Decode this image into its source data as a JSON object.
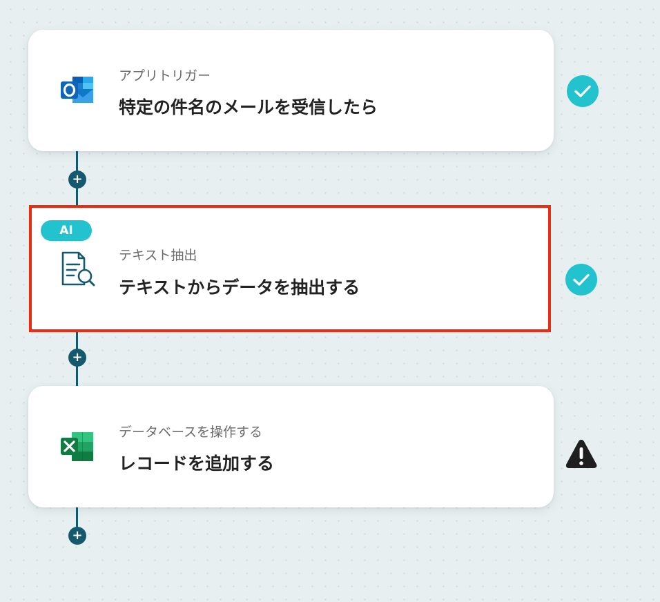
{
  "flow": {
    "steps": [
      {
        "subtitle": "アプリトリガー",
        "title": "特定の件名のメールを受信したら",
        "icon": "outlook-icon",
        "status": "complete",
        "status_icon": "check-circle-icon"
      },
      {
        "badge": "AI",
        "subtitle": "テキスト抽出",
        "title": "テキストからデータを抽出する",
        "icon": "document-search-icon",
        "status": "complete",
        "status_icon": "check-circle-icon",
        "selected": true
      },
      {
        "subtitle": "データベースを操作する",
        "title": "レコードを追加する",
        "icon": "excel-icon",
        "status": "warning",
        "status_icon": "warning-icon"
      }
    ],
    "add_step_label": "+"
  },
  "colors": {
    "connector": "#15596e",
    "check": "#22c3cf",
    "highlight": "#ee2a10",
    "ai_badge": "#22c3cf",
    "warning": "#1f1f1f"
  }
}
